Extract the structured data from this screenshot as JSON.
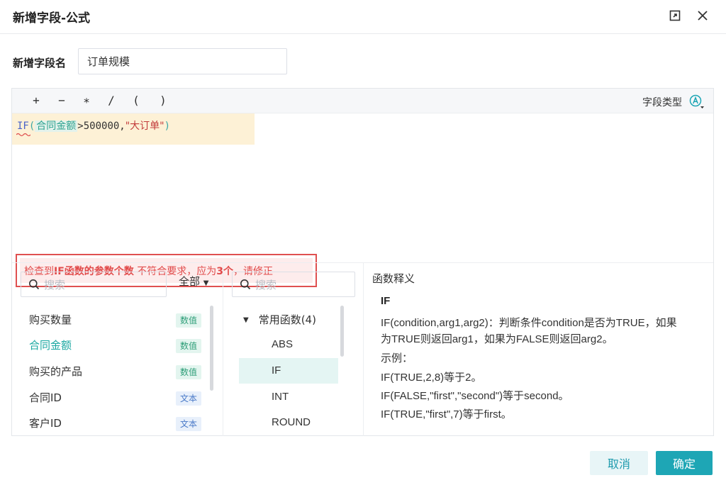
{
  "dialog": {
    "title": "新增字段-公式"
  },
  "name_field": {
    "label": "新增字段名",
    "value": "订单规模"
  },
  "toolbar": {
    "operators": [
      "+",
      "−",
      "∗",
      "/",
      "(",
      ")"
    ],
    "field_type_label": "字段类型",
    "field_type_icon": "letter-a-circle-icon"
  },
  "formula": {
    "fn": "IF",
    "open_paren": "(",
    "field": "合同金额",
    "rest": ">500000,",
    "string": "\"大订单\"",
    "close_paren": ")"
  },
  "error": {
    "part1": "检查到",
    "part2": "IF函数的参数个数",
    "part3": "不符合要求，应为",
    "part4": "3个",
    "part5": "，请修正"
  },
  "fields_panel": {
    "search_placeholder": "搜索",
    "filter_label": "全部",
    "items": [
      {
        "name": "购买数量",
        "tag": "数值"
      },
      {
        "name": "合同金额",
        "tag": "数值"
      },
      {
        "name": "购买的产品",
        "tag": "数值"
      },
      {
        "name": "合同ID",
        "tag": "文本"
      },
      {
        "name": "客户ID",
        "tag": "文本"
      }
    ]
  },
  "functions_panel": {
    "search_placeholder": "搜索",
    "group_label": "常用函数(4)",
    "items": [
      "ABS",
      "IF",
      "INT",
      "ROUND"
    ]
  },
  "explanation": {
    "title": "函数释义",
    "fn_name": "IF",
    "desc_line1": "IF(condition,arg1,arg2)：判断条件condition是否为TRUE，如果",
    "desc_line2": "为TRUE则返回arg1，如果为FALSE则返回arg2。",
    "example_label": "示例：",
    "examples": [
      "IF(TRUE,2,8)等于2。",
      "IF(FALSE,\"first\",\"second\")等于second。",
      "IF(TRUE,\"first\",7)等于first。"
    ]
  },
  "footer": {
    "cancel_label": "取消",
    "ok_label": "确定"
  },
  "colors": {
    "accent": "#1ea6b5",
    "error": "#e14b4b",
    "field_highlight": "#2fa38f"
  }
}
